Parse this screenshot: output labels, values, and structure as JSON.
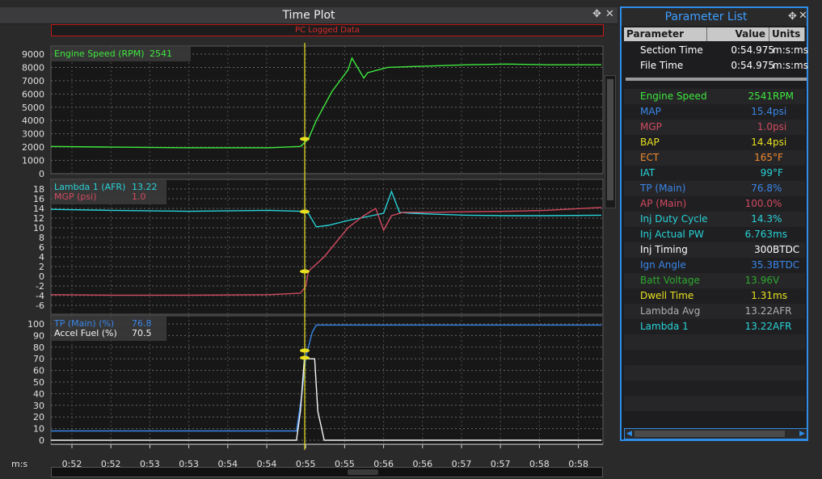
{
  "time_plot": {
    "title": "Time Plot",
    "banner": "PC Logged Data",
    "x_unit": "m:s",
    "x_ticks": [
      "0:52",
      "0:52",
      "0:53",
      "0:53",
      "0:54",
      "0:54",
      "0:55",
      "0:55",
      "0:56",
      "0:56",
      "0:57",
      "0:57",
      "0:58",
      "0:58"
    ],
    "panels": [
      {
        "y_ticks": [
          "9000",
          "8000",
          "7000",
          "6000",
          "5000",
          "4000",
          "3000",
          "2000",
          "1000",
          "0"
        ],
        "legend": [
          {
            "label": "Engine Speed (RPM)",
            "value": "2541",
            "color": "#3ee83e"
          }
        ]
      },
      {
        "y_ticks": [
          "18",
          "16",
          "14",
          "12",
          "10",
          "8",
          "6",
          "4",
          "2",
          "0",
          "-2",
          "-4",
          "-6"
        ],
        "legend": [
          {
            "label": "Lambda 1 (AFR)",
            "value": "13.22",
            "color": "#28d3d8"
          },
          {
            "label": "MGP (psi)",
            "value": "1.0",
            "color": "#d24a60"
          }
        ]
      },
      {
        "y_ticks": [
          "100",
          "90",
          "80",
          "70",
          "60",
          "50",
          "40",
          "30",
          "20",
          "10",
          "0"
        ],
        "legend": [
          {
            "label": "TP (Main) (%)",
            "value": "76.8",
            "color": "#3a86e8"
          },
          {
            "label": "Accel Fuel (%)",
            "value": "70.5",
            "color": "#f5f5f5"
          }
        ]
      }
    ],
    "cursor_color": "#e8e020"
  },
  "param_list": {
    "title": "Parameter List",
    "headers": {
      "parameter": "Parameter",
      "value": "Value",
      "units": "Units"
    },
    "time_rows": [
      {
        "name": "Section Time",
        "value": "0:54.975",
        "unit": "m:s:ms",
        "color": "#ffffff"
      },
      {
        "name": "File Time",
        "value": "0:54.975",
        "unit": "m:s:ms",
        "color": "#ffffff"
      }
    ],
    "rows": [
      {
        "name": "Engine Speed",
        "value": "2541",
        "unit": "RPM",
        "color": "#3ee83e"
      },
      {
        "name": "MAP",
        "value": "15.4",
        "unit": "psi",
        "color": "#3a86e8"
      },
      {
        "name": "MGP",
        "value": "1.0",
        "unit": "psi",
        "color": "#d24a60"
      },
      {
        "name": "BAP",
        "value": "14.4",
        "unit": "psi",
        "color": "#e8e020"
      },
      {
        "name": "ECT",
        "value": "165",
        "unit": "°F",
        "color": "#f08a30"
      },
      {
        "name": "IAT",
        "value": "99",
        "unit": "°F",
        "color": "#28d3d8"
      },
      {
        "name": "TP (Main)",
        "value": "76.8",
        "unit": "%",
        "color": "#3a86e8"
      },
      {
        "name": "AP (Main)",
        "value": "100.0",
        "unit": "%",
        "color": "#d24a60"
      },
      {
        "name": "Inj Duty Cycle",
        "value": "14.3",
        "unit": "%",
        "color": "#28d3d8"
      },
      {
        "name": "Inj Actual PW",
        "value": "6.763",
        "unit": "ms",
        "color": "#28d3d8"
      },
      {
        "name": "Inj Timing",
        "value": "300",
        "unit": "BTDC",
        "color": "#ffffff"
      },
      {
        "name": "Ign Angle",
        "value": "35.3",
        "unit": "BTDC",
        "color": "#3a86e8"
      },
      {
        "name": "Batt Voltage",
        "value": "13.96",
        "unit": "V",
        "color": "#2ea82e"
      },
      {
        "name": "Dwell Time",
        "value": "1.31",
        "unit": "ms",
        "color": "#e8e020"
      },
      {
        "name": "Lambda Avg",
        "value": "13.22",
        "unit": "AFR",
        "color": "#b0b0b0"
      },
      {
        "name": "Lambda 1",
        "value": "13.22",
        "unit": "AFR",
        "color": "#28d3d8"
      }
    ]
  },
  "chart_data": [
    {
      "type": "line",
      "ylim": [
        0,
        9000
      ],
      "series": [
        {
          "name": "Engine Speed (RPM)",
          "color": "#3ee83e",
          "x": [
            51.75,
            52.5,
            53.5,
            54.5,
            54.9,
            55.0,
            55.1,
            55.3,
            55.5,
            55.55,
            55.62,
            55.7,
            55.75,
            56.0,
            56.5,
            57.0,
            57.5,
            58.0,
            58.7
          ],
          "y": [
            2050,
            2000,
            1950,
            1950,
            2050,
            2600,
            4000,
            6200,
            7800,
            8700,
            8000,
            7200,
            7600,
            8000,
            8100,
            8200,
            8250,
            8200,
            8200
          ]
        }
      ]
    },
    {
      "type": "line",
      "ylim": [
        -6,
        18
      ],
      "series": [
        {
          "name": "Lambda 1 (AFR)",
          "color": "#28d3d8",
          "x": [
            51.75,
            52.5,
            53.5,
            54.5,
            54.9,
            55.0,
            55.1,
            55.25,
            55.5,
            55.8,
            55.95,
            56.05,
            56.15,
            56.3,
            56.6,
            57.0,
            57.5,
            58.0,
            58.7
          ],
          "y": [
            13.8,
            13.6,
            13.4,
            13.6,
            13.4,
            13.0,
            10.2,
            10.5,
            11.5,
            12.5,
            13.0,
            17.5,
            13.2,
            13.0,
            12.8,
            12.6,
            12.5,
            12.5,
            12.6
          ]
        },
        {
          "name": "MGP (psi)",
          "color": "#d24a60",
          "x": [
            51.75,
            52.5,
            53.5,
            54.5,
            54.9,
            54.97,
            55.0,
            55.2,
            55.5,
            55.7,
            55.85,
            55.95,
            56.05,
            56.2,
            56.6,
            57.0,
            57.5,
            58.0,
            58.7
          ],
          "y": [
            -3.8,
            -3.9,
            -3.9,
            -3.8,
            -3.5,
            -2.0,
            1.0,
            4.0,
            10.0,
            12.5,
            14.0,
            9.5,
            12.5,
            13.2,
            13.2,
            13.3,
            13.4,
            13.6,
            14.2
          ]
        }
      ]
    },
    {
      "type": "line",
      "ylim": [
        0,
        100
      ],
      "series": [
        {
          "name": "TP (Main) (%)",
          "color": "#3a86e8",
          "x": [
            51.75,
            52.5,
            53.5,
            54.5,
            54.85,
            54.92,
            54.97,
            55.05,
            55.1,
            58.7
          ],
          "y": [
            8,
            8,
            8,
            8,
            8,
            40,
            72,
            93,
            99,
            99
          ]
        },
        {
          "name": "Accel Fuel (%)",
          "color": "#f5f5f5",
          "x": [
            51.75,
            54.85,
            54.9,
            54.95,
            55.0,
            55.08,
            55.12,
            55.2,
            58.7
          ],
          "y": [
            0,
            0,
            25,
            70,
            70,
            70,
            25,
            0,
            0
          ]
        }
      ]
    }
  ]
}
